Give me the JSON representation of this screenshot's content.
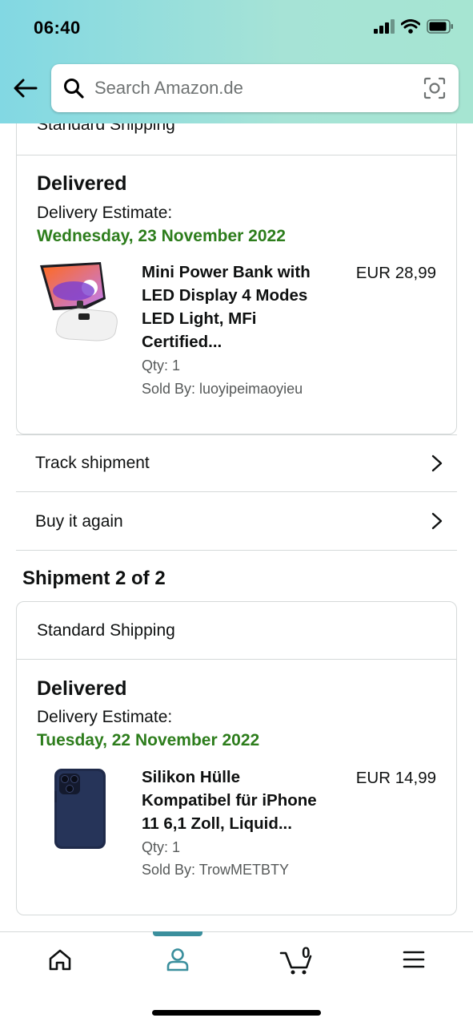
{
  "status_bar": {
    "time": "06:40"
  },
  "search": {
    "placeholder": "Search Amazon.de"
  },
  "shipment1": {
    "shipping_method": "Standard Shipping",
    "status": "Delivered",
    "estimate_label": "Delivery Estimate:",
    "estimate_date": "Wednesday, 23 November 2022",
    "product": {
      "title_lines": [
        "Mini Power Bank with",
        "LED Display 4 Modes",
        "LED Light, MFi",
        "Certified..."
      ],
      "price": "EUR 28,99",
      "qty": "Qty: 1",
      "seller": "Sold By: luoyipeimaoyieu"
    },
    "actions": {
      "track": "Track shipment",
      "buy_again": "Buy it again"
    }
  },
  "shipment2": {
    "heading": "Shipment 2 of 2",
    "shipping_method": "Standard Shipping",
    "status": "Delivered",
    "estimate_label": "Delivery Estimate:",
    "estimate_date": "Tuesday, 22 November 2022",
    "product": {
      "title_lines": [
        "Silikon Hülle",
        "Kompatibel für iPhone",
        "11 6,1 Zoll, Liquid..."
      ],
      "price": "EUR 14,99",
      "qty": "Qty: 1",
      "seller": "Sold By: TrowMETBTY"
    }
  },
  "bottom_nav": {
    "items": [
      "home-icon",
      "profile-icon",
      "cart-icon",
      "menu-icon"
    ],
    "active": "profile-icon",
    "cart_count": "0"
  },
  "colors": {
    "accent_green": "#2d7d1c",
    "nav_active": "#3b8f9d",
    "border": "#d5d9d9"
  }
}
